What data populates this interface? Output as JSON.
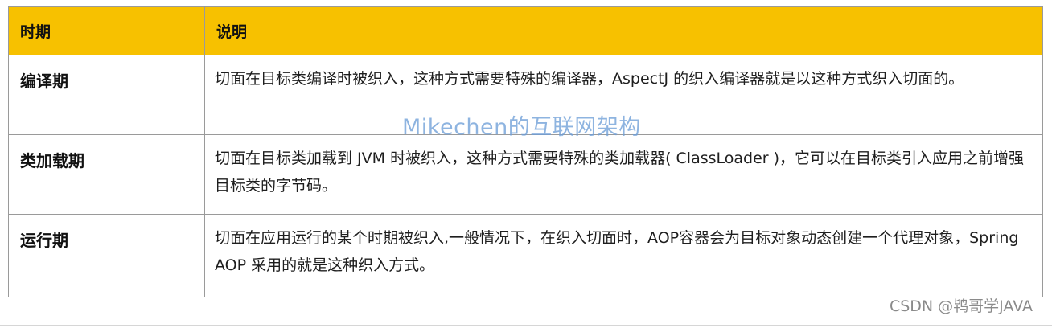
{
  "table": {
    "header": {
      "phase": "时期",
      "description": "说明"
    },
    "rows": [
      {
        "phase": "编译期",
        "description": "切面在目标类编译时被织入，这种方式需要特殊的编译器，AspectJ 的织入编译器就是以这种方式织入切面的。"
      },
      {
        "phase": "类加载期",
        "description": "切面在目标类加载到 JVM 时被织入，这种方式需要特殊的类加载器( ClassLoader )，它可以在目标类引入应用之前增强目标类的字节码。"
      },
      {
        "phase": "运行期",
        "description": "切面在应用运行的某个时期被织入,一般情况下，在织入切面时，AOP容器会为目标对象动态创建一个代理对象，Spring AOP 采用的就是这种织入方式。"
      }
    ]
  },
  "watermarks": {
    "center": "Mikechen的互联网架构",
    "corner": "CSDN @鸨哥学JAVA"
  },
  "colors": {
    "header_background": "#f7c100",
    "border": "#9a9a9a",
    "watermark_center": "#6f9fd8",
    "watermark_corner": "#8a8a8a"
  }
}
